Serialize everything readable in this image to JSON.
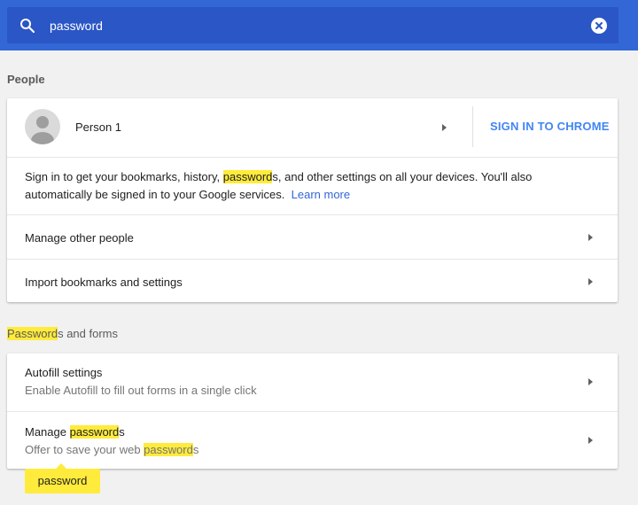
{
  "search": {
    "value": "password",
    "icon": "search-icon",
    "clear_icon": "clear-icon"
  },
  "colors": {
    "header": "#3367d6",
    "search_box": "#2a56c6",
    "highlight": "#ffeb3b",
    "link": "#3367d6",
    "sign_in": "#4285f4"
  },
  "people": {
    "title": "People",
    "person": {
      "name": "Person 1",
      "avatar_icon": "avatar-icon"
    },
    "sign_in_label": "SIGN IN TO CHROME",
    "info": {
      "t1": "Sign in to get your bookmarks, history, ",
      "h1": "password",
      "t2": "s, and other settings on all your devices. You'll also automatically be signed in to your Google services.",
      "link": "Learn more"
    },
    "manage_other": "Manage other people",
    "import": "Import bookmarks and settings"
  },
  "passwords": {
    "title_hl": "Password",
    "title_rest": "s and forms",
    "autofill": {
      "label": "Autofill settings",
      "sub": "Enable Autofill to fill out forms in a single click"
    },
    "manage": {
      "label_pre": "Manage ",
      "label_hl": "password",
      "label_post": "s",
      "sub_pre": "Offer to save your web ",
      "sub_hl": "password",
      "sub_post": "s"
    }
  },
  "tooltip": "password"
}
